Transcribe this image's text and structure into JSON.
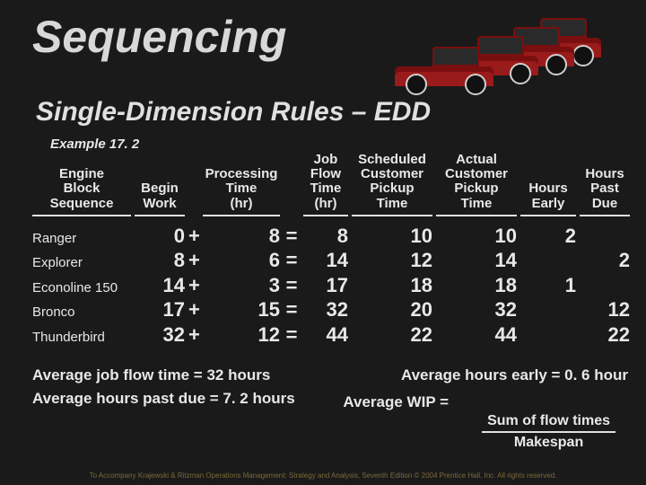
{
  "title": "Sequencing",
  "subtitle": "Single-Dimension Rules – EDD",
  "example": "Example 17. 2",
  "headers": {
    "engine": "Engine\nBlock\nSequence",
    "begin": "Begin\nWork",
    "proc": "Processing\nTime\n(hr)",
    "flow": "Job\nFlow\nTime\n(hr)",
    "sched": "Scheduled\nCustomer\nPickup\nTime",
    "actual": "Actual\nCustomer\nPickup\nTime",
    "early": "Hours\nEarly",
    "past": "Hours\nPast\nDue"
  },
  "rows": [
    {
      "name": "Ranger",
      "begin": "0",
      "op": "+",
      "proc": "8",
      "eq": "=",
      "flow": "8",
      "sched": "10",
      "actual": "10",
      "early": "2",
      "past": ""
    },
    {
      "name": "Explorer",
      "begin": "8",
      "op": "+",
      "proc": "6",
      "eq": "=",
      "flow": "14",
      "sched": "12",
      "actual": "14",
      "early": "",
      "past": "2"
    },
    {
      "name": "Econoline 150",
      "begin": "14",
      "op": "+",
      "proc": "3",
      "eq": "=",
      "flow": "17",
      "sched": "18",
      "actual": "18",
      "early": "1",
      "past": ""
    },
    {
      "name": "Bronco",
      "begin": "17",
      "op": "+",
      "proc": "15",
      "eq": "=",
      "flow": "32",
      "sched": "20",
      "actual": "32",
      "early": "",
      "past": "12"
    },
    {
      "name": "Thunderbird",
      "begin": "32",
      "op": "+",
      "proc": "12",
      "eq": "=",
      "flow": "44",
      "sched": "22",
      "actual": "44",
      "early": "",
      "past": "22"
    }
  ],
  "stats": {
    "avg_flow": "Average job flow time = 32 hours",
    "avg_early": "Average hours early = 0. 6 hour",
    "avg_past": "Average hours past due = 7. 2 hours",
    "wip_label": "Average WIP =",
    "frac_top": "Sum of flow times",
    "frac_bot": "Makespan"
  },
  "footer": "To Accompany Krajewski & Ritzman Operations Management: Strategy and Analysis, Seventh Edition © 2004 Prentice Hall, Inc. All rights reserved."
}
